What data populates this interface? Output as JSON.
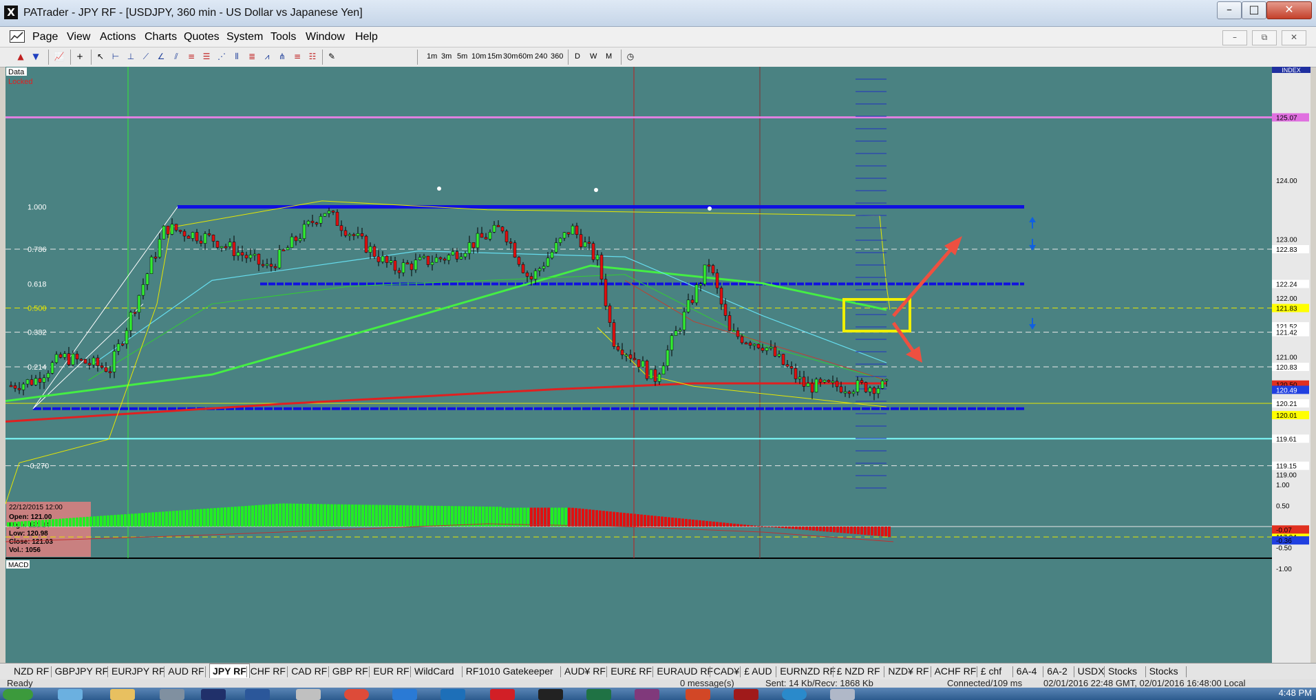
{
  "window": {
    "title": "PATrader - JPY RF - [USDJPY, 360 min - US Dollar vs Japanese Yen]",
    "minimize": "–",
    "maximize": "□",
    "close": "✕"
  },
  "menu": [
    "Page",
    "View",
    "Actions",
    "Charts",
    "Quotes",
    "System",
    "Tools",
    "Window",
    "Help"
  ],
  "mdi": {
    "minimize": "–",
    "restore": "⧉",
    "close": "✕"
  },
  "toolbar": {
    "timeframes": [
      "1m",
      "3m",
      "5m",
      "10m",
      "15m",
      "30m",
      "60m",
      "240",
      "360",
      "D",
      "W",
      "M"
    ]
  },
  "chart": {
    "data_label": "Data",
    "locked_label": "Locked",
    "index_label": "INDEX",
    "macd_label": "MACD",
    "price_labels": [
      {
        "text": "125.07",
        "bg": "#e070e0",
        "fg": "#000000",
        "y": 125.07
      },
      {
        "text": "124.00",
        "bg": "",
        "fg": "#000000",
        "y": 124.0
      },
      {
        "text": "123.00",
        "bg": "",
        "fg": "#000000",
        "y": 123.0
      },
      {
        "text": "122.83",
        "bg": "#ffffff",
        "fg": "#000000",
        "y": 122.83
      },
      {
        "text": "122.24",
        "bg": "#ffffff",
        "fg": "#000000",
        "y": 122.24
      },
      {
        "text": "122.00",
        "bg": "",
        "fg": "#000000",
        "y": 122.0
      },
      {
        "text": "121.83",
        "bg": "#ffff00",
        "fg": "#000000",
        "y": 121.83
      },
      {
        "text": "121.52",
        "bg": "#ffffff",
        "fg": "#000000",
        "y": 121.52
      },
      {
        "text": "121.42",
        "bg": "#ffffff",
        "fg": "#000000",
        "y": 121.42
      },
      {
        "text": "121.00",
        "bg": "",
        "fg": "#000000",
        "y": 121.0
      },
      {
        "text": "120.83",
        "bg": "#ffffff",
        "fg": "#000000",
        "y": 120.83
      },
      {
        "text": "120.50",
        "bg": "#e03020",
        "fg": "#000000",
        "y": 120.53
      },
      {
        "text": "120.49",
        "bg": "#2040e0",
        "fg": "#ffffff",
        "y": 120.44
      },
      {
        "text": "120.21",
        "bg": "#ffffff",
        "fg": "#000000",
        "y": 120.21
      },
      {
        "text": "120.01",
        "bg": "#ffff00",
        "fg": "#000000",
        "y": 120.01
      },
      {
        "text": "119.61",
        "bg": "#ffffff",
        "fg": "#000000",
        "y": 119.61
      },
      {
        "text": "119.15",
        "bg": "#ffffff",
        "fg": "#000000",
        "y": 119.15
      },
      {
        "text": "119.00",
        "bg": "",
        "fg": "#000000",
        "y": 119.0
      },
      {
        "text": "117.94",
        "bg": "#ffff00",
        "fg": "#000000",
        "y": 117.94
      }
    ],
    "fib_labels": [
      {
        "text": "1.000",
        "y": 123.55
      },
      {
        "text": "0.786",
        "y": 122.83
      },
      {
        "text": "0.618",
        "y": 122.24
      },
      {
        "text": "0.500",
        "y": 121.83
      },
      {
        "text": "0.382",
        "y": 121.42
      },
      {
        "text": "0.214",
        "y": 120.83
      },
      {
        "text": "-0.270",
        "y": 119.15
      }
    ],
    "info_box": {
      "date": "22/12/2015 12:00",
      "open": "Open: 121.00",
      "high": "High: 121.14",
      "low": "Low: 120.98",
      "close": "Close: 121.03",
      "vol": "Vol.: 1056"
    },
    "macd_labels": [
      {
        "text": "1.00",
        "bg": "",
        "fg": "#000000",
        "v": 1.0
      },
      {
        "text": "0.50",
        "bg": "",
        "fg": "#000000",
        "v": 0.5
      },
      {
        "text": "-0.07",
        "bg": "#e03020",
        "fg": "#000000",
        "v": -0.07
      },
      {
        "text": "-0.36",
        "bg": "#2040e0",
        "fg": "#000000",
        "v": -0.33
      },
      {
        "text": "-0.50",
        "bg": "",
        "fg": "#000000",
        "v": -0.5
      },
      {
        "text": "-1.00",
        "bg": "",
        "fg": "#000000",
        "v": -1.0
      }
    ],
    "colors": {
      "background": "#4a8282",
      "bull": "#33ee33",
      "bear": "#e01010",
      "support": "#1010e0",
      "fib_line": "#e8e8e8",
      "fib_yellow": "#e8e800",
      "magenta": "#e080e0",
      "cyan": "#80ffff"
    }
  },
  "tabs": [
    "NZD RF",
    "GBPJPY RF",
    "EURJPY RF",
    "AUD RF",
    "JPY RF",
    "CHF RF",
    "CAD RF",
    "GBP RF",
    "EUR RF",
    "WildCard",
    "RF1010 Gatekeeper",
    "AUD¥ RF",
    "EUR£ RF",
    "EURAUD RF",
    "CAD¥",
    "£ AUD",
    "EURNZD RF",
    "£ NZD RF",
    "NZD¥ RF",
    "ACHF RF",
    "£ chf",
    "6A-4",
    "6A-2",
    "USDX",
    "Stocks",
    "Stocks"
  ],
  "active_tab": "JPY RF",
  "status": {
    "ready": "Ready",
    "messages": "0 message(s)",
    "traffic": "Sent: 14 Kb/Recv: 1868 Kb",
    "connection": "Connected/109 ms",
    "time": "02/01/2016 22:48 GMT, 02/01/2016 16:48:00 Local"
  },
  "taskbar": {
    "clock": "4:48 PM"
  }
}
